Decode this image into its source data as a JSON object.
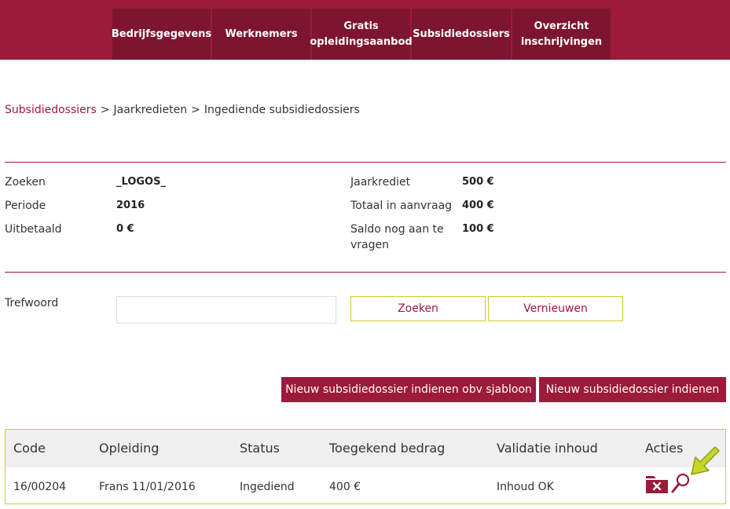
{
  "nav": {
    "items": [
      {
        "label": "Bedrijfsgegevens"
      },
      {
        "label": "Werknemers"
      },
      {
        "label": "Gratis opleidingsaanbod"
      },
      {
        "label": "Subsidiedossiers"
      },
      {
        "label": "Overzicht inschrijvingen"
      }
    ]
  },
  "breadcrumb": {
    "items": [
      "Subsidiedossiers",
      "Jaarkredieten",
      "Ingediende subsidiedossiers"
    ],
    "separator": ">"
  },
  "info": {
    "zoeken_label": "Zoeken",
    "zoeken_value": "_LOGOS_",
    "periode_label": "Periode",
    "periode_value": "2016",
    "uitbetaald_label": "Uitbetaald",
    "uitbetaald_value": "0 €",
    "jaarkrediet_label": "Jaarkrediet",
    "jaarkrediet_value": "500 €",
    "totaal_label": "Totaal in aanvraag",
    "totaal_value": "400 €",
    "saldo_label": "Saldo nog aan te vragen",
    "saldo_value": "100 €"
  },
  "search": {
    "label": "Trefwoord",
    "value": "",
    "placeholder": "",
    "zoeken_button": "Zoeken",
    "vernieuwen_button": "Vernieuwen"
  },
  "actions": {
    "template_button": "Nieuw subsidiedossier indienen obv sjabloon",
    "new_button": "Nieuw subsidiedossier indienen"
  },
  "table": {
    "headers": {
      "code": "Code",
      "opleiding": "Opleiding",
      "status": "Status",
      "bedrag": "Toegekend bedrag",
      "validatie": "Validatie inhoud",
      "acties": "Acties"
    },
    "rows": [
      {
        "code": "16/00204",
        "opleiding": "Frans 11/01/2016",
        "status": "Ingediend",
        "bedrag": "400 €",
        "validatie": "Inhoud OK",
        "actions": [
          "delete-folder-icon",
          "magnifier-icon"
        ]
      }
    ]
  },
  "colors": {
    "brand": "#9c1a3a",
    "brand_dark": "#7e1530",
    "accent_border": "#c8cf2a",
    "highlight_arrow": "#c8d62a",
    "table_header_bg": "#efefef"
  }
}
